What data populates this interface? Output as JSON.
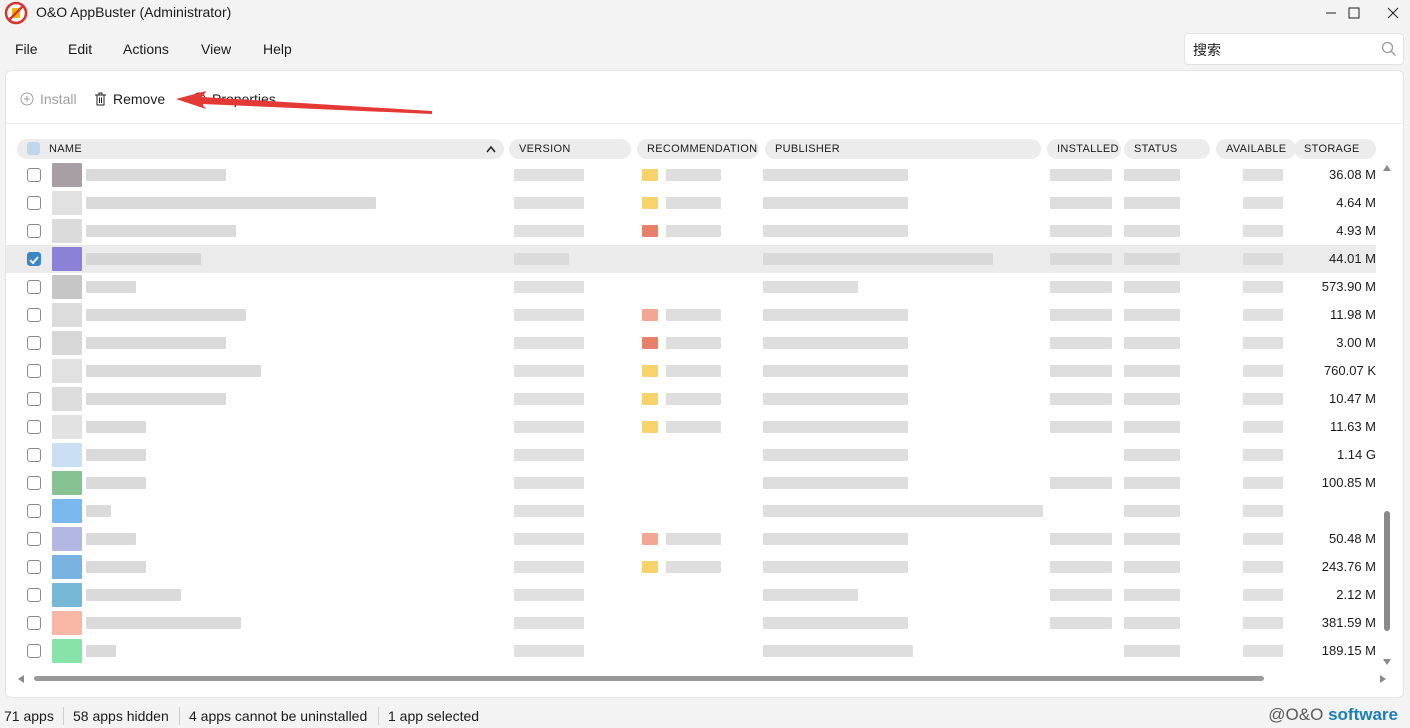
{
  "window": {
    "title": "O&O AppBuster (Administrator)"
  },
  "menu": [
    "File",
    "Edit",
    "Actions",
    "View",
    "Help"
  ],
  "search": {
    "value": "搜索"
  },
  "toolbar": {
    "install": "Install",
    "remove": "Remove",
    "properties": "Properties"
  },
  "columns": [
    "NAME",
    "VERSION",
    "RECOMMENDATION",
    "PUBLISHER",
    "INSTALLED",
    "STATUS",
    "AVAILABLE",
    "STORAGE"
  ],
  "rows": [
    {
      "storage": "36.08 M",
      "checked": false
    },
    {
      "storage": "4.64 M",
      "checked": false
    },
    {
      "storage": "4.93 M",
      "checked": false
    },
    {
      "storage": "44.01 M",
      "checked": true
    },
    {
      "storage": "573.90 M",
      "checked": false
    },
    {
      "storage": "11.98 M",
      "checked": false
    },
    {
      "storage": "3.00 M",
      "checked": false
    },
    {
      "storage": "760.07 K",
      "checked": false
    },
    {
      "storage": "10.47 M",
      "checked": false
    },
    {
      "storage": "11.63 M",
      "checked": false
    },
    {
      "storage": "1.14 G",
      "checked": false
    },
    {
      "storage": "100.85 M",
      "checked": false
    },
    {
      "storage": "",
      "checked": false
    },
    {
      "storage": "50.48 M",
      "checked": false
    },
    {
      "storage": "243.76 M",
      "checked": false
    },
    {
      "storage": "2.12 M",
      "checked": false
    },
    {
      "storage": "381.59 M",
      "checked": false
    },
    {
      "storage": "189.15 M",
      "checked": false
    }
  ],
  "status": {
    "apps": "71 apps",
    "hidden": "58 apps hidden",
    "cannot": "4 apps cannot be uninstalled",
    "selected": "1 app selected",
    "brand_prefix": "O&O",
    "brand_suffix": "software"
  },
  "colors": {
    "accent": "#3d86c6",
    "arrow": "#e53935"
  }
}
